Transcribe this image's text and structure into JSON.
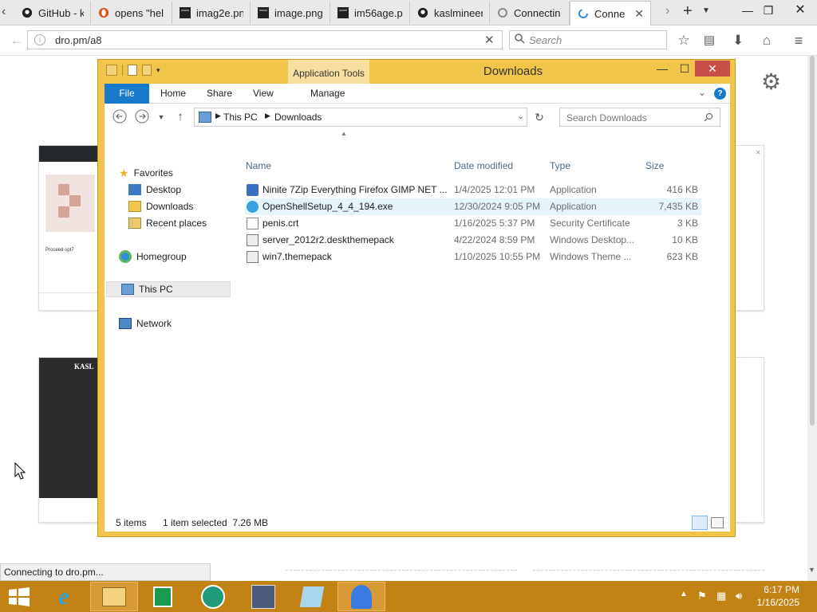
{
  "browser": {
    "tabs": [
      {
        "label": "GitHub - k",
        "icon": "github-icon"
      },
      {
        "label": "opens \"hel",
        "icon": "opera-icon"
      },
      {
        "label": "imag2e.pn",
        "icon": "image-icon"
      },
      {
        "label": "image.png",
        "icon": "image-icon"
      },
      {
        "label": "im56age.p",
        "icon": "image-icon"
      },
      {
        "label": "kaslmineer",
        "icon": "github-icon"
      },
      {
        "label": "Connectin",
        "icon": "loading-icon"
      },
      {
        "label": "Conne",
        "icon": "loading-icon"
      }
    ],
    "url": "dro.pm/a8",
    "search_placeholder": "Search",
    "status": "Connecting to dro.pm..."
  },
  "page": {
    "card1_title": "Proceed-spt7",
    "card2_title": "KASL"
  },
  "explorer": {
    "title": "Downloads",
    "app_tools": "Application Tools",
    "ribbon_tabs": [
      "File",
      "Home",
      "Share",
      "View",
      "Manage"
    ],
    "breadcrumb": [
      "This PC",
      "Downloads"
    ],
    "search_placeholder": "Search Downloads",
    "nav": {
      "favorites": "Favorites",
      "desktop": "Desktop",
      "downloads": "Downloads",
      "recent": "Recent places",
      "homegroup": "Homegroup",
      "thispc": "This PC",
      "network": "Network"
    },
    "columns": [
      "Name",
      "Date modified",
      "Type",
      "Size"
    ],
    "files": [
      {
        "name": "Ninite 7Zip Everything Firefox GIMP NET ...",
        "date": "1/4/2025 12:01 PM",
        "type": "Application",
        "size": "416 KB",
        "icon": "installer-icon"
      },
      {
        "name": "OpenShellSetup_4_4_194.exe",
        "date": "12/30/2024 9:05 PM",
        "type": "Application",
        "size": "7,435 KB",
        "icon": "shell-icon"
      },
      {
        "name": "penis.crt",
        "date": "1/16/2025 5:37 PM",
        "type": "Security Certificate",
        "size": "3 KB",
        "icon": "certificate-icon"
      },
      {
        "name": "server_2012r2.deskthemepack",
        "date": "4/22/2024 8:59 PM",
        "type": "Windows Desktop...",
        "size": "10 KB",
        "icon": "themepack-icon"
      },
      {
        "name": "win7.themepack",
        "date": "1/10/2025 10:55 PM",
        "type": "Windows Theme ...",
        "size": "623 KB",
        "icon": "themepack-icon"
      }
    ],
    "status_count": "5 items",
    "status_selected": "1 item selected  7.26 MB"
  },
  "taskbar": {
    "time": "6:17 PM",
    "date": "1/16/2025",
    "accent": "#c28214"
  }
}
